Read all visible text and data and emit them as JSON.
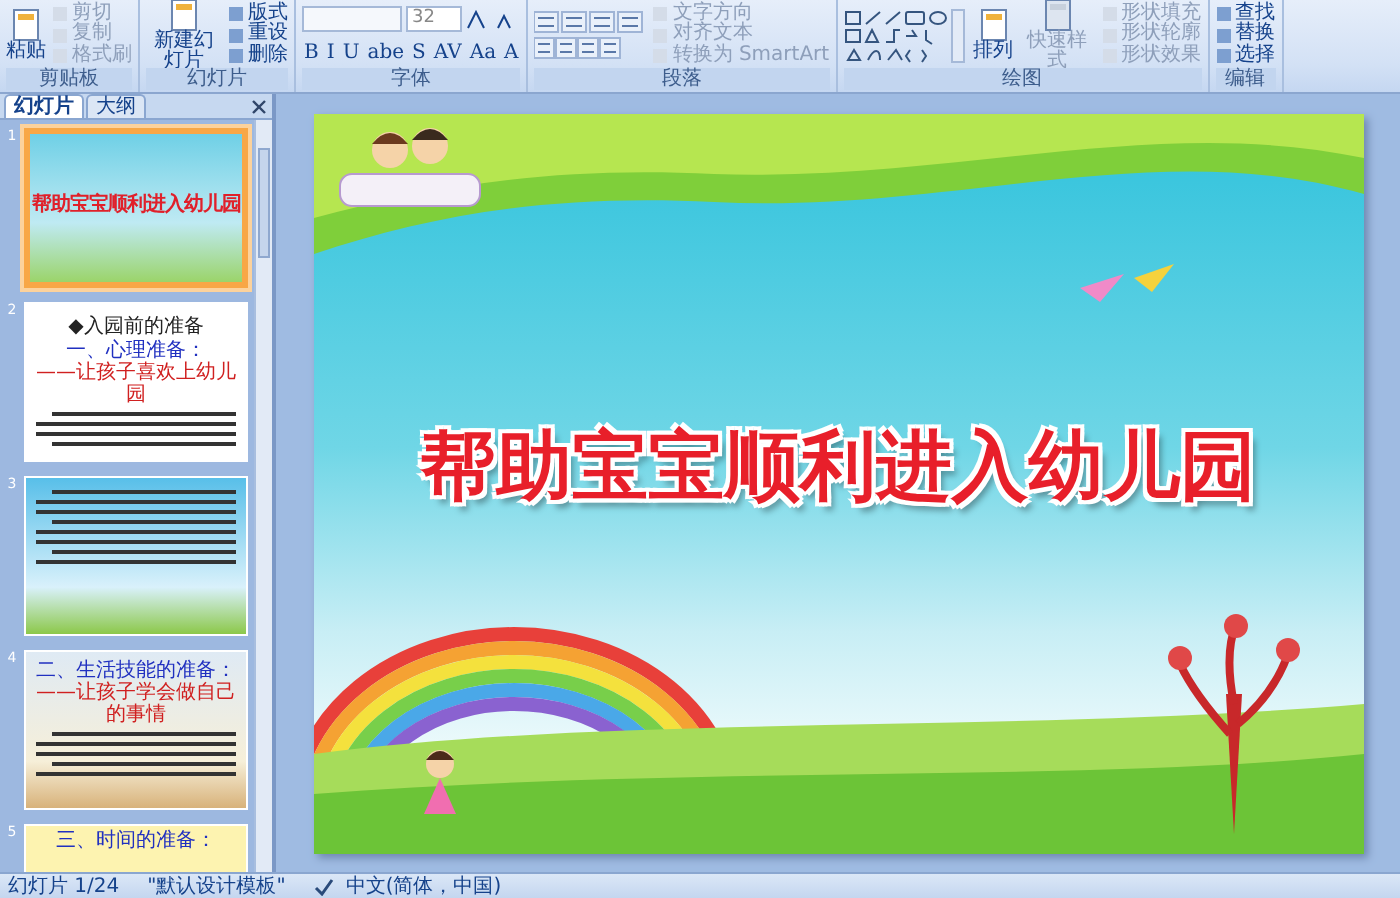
{
  "ribbon": {
    "groups": [
      {
        "label": "剪贴板",
        "items": [
          {
            "kind": "large",
            "label": "粘贴",
            "disabled": false
          },
          {
            "kind": "small",
            "label": "剪切",
            "disabled": true
          },
          {
            "kind": "small",
            "label": "复制",
            "disabled": true
          },
          {
            "kind": "small",
            "label": "格式刷",
            "disabled": true
          }
        ]
      },
      {
        "label": "幻灯片",
        "items": [
          {
            "kind": "large",
            "label": "新建幻灯片",
            "disabled": false
          },
          {
            "kind": "small",
            "label": "版式",
            "disabled": false
          },
          {
            "kind": "small",
            "label": "重设",
            "disabled": false
          },
          {
            "kind": "small",
            "label": "删除",
            "disabled": false
          }
        ]
      },
      {
        "label": "字体",
        "items": [
          {
            "kind": "font",
            "size": "32",
            "glyphs": [
              "B",
              "I",
              "U",
              "abe",
              "S",
              "AV",
              "Aa",
              "A"
            ]
          }
        ]
      },
      {
        "label": "段落",
        "items": [
          {
            "kind": "para"
          },
          {
            "kind": "small",
            "label": "文字方向",
            "disabled": true
          },
          {
            "kind": "small",
            "label": "对齐文本",
            "disabled": true
          },
          {
            "kind": "small",
            "label": "转换为 SmartArt",
            "disabled": true
          }
        ]
      },
      {
        "label": "绘图",
        "items": [
          {
            "kind": "shapes"
          },
          {
            "kind": "large",
            "label": "排列",
            "disabled": false
          },
          {
            "kind": "large",
            "label": "快速样式",
            "disabled": true
          },
          {
            "kind": "small",
            "label": "形状填充",
            "disabled": true
          },
          {
            "kind": "small",
            "label": "形状轮廓",
            "disabled": true
          },
          {
            "kind": "small",
            "label": "形状效果",
            "disabled": true
          }
        ]
      },
      {
        "label": "编辑",
        "items": [
          {
            "kind": "small",
            "label": "查找",
            "disabled": false
          },
          {
            "kind": "small",
            "label": "替换",
            "disabled": false
          },
          {
            "kind": "small",
            "label": "选择",
            "disabled": false
          }
        ]
      }
    ]
  },
  "panel": {
    "tabs": [
      {
        "label": "幻灯片",
        "selected": true
      },
      {
        "label": "大纲",
        "selected": false
      }
    ],
    "thumbnails": [
      {
        "number": "1",
        "selected": true,
        "kind": "cover",
        "title": "帮助宝宝顺利进入幼儿园"
      },
      {
        "number": "2",
        "selected": false,
        "kind": "white",
        "heading": "◆入园前的准备",
        "subheading": "一、心理准备：",
        "subtitle": "——让孩子喜欢上幼儿园"
      },
      {
        "number": "3",
        "selected": false,
        "kind": "sky"
      },
      {
        "number": "4",
        "selected": false,
        "kind": "sand",
        "heading": "二、生活技能的准备：",
        "subtitle": "——让孩子学会做自己的事情"
      },
      {
        "number": "5",
        "selected": false,
        "kind": "note",
        "heading": "三、时间的准备："
      }
    ]
  },
  "slide": {
    "title": "帮助宝宝顺利进入幼儿园"
  },
  "status_bar": {
    "slide_counter": "幻灯片 1/24",
    "theme": "\"默认设计模板\"",
    "language": "中文(简体，中国)"
  }
}
